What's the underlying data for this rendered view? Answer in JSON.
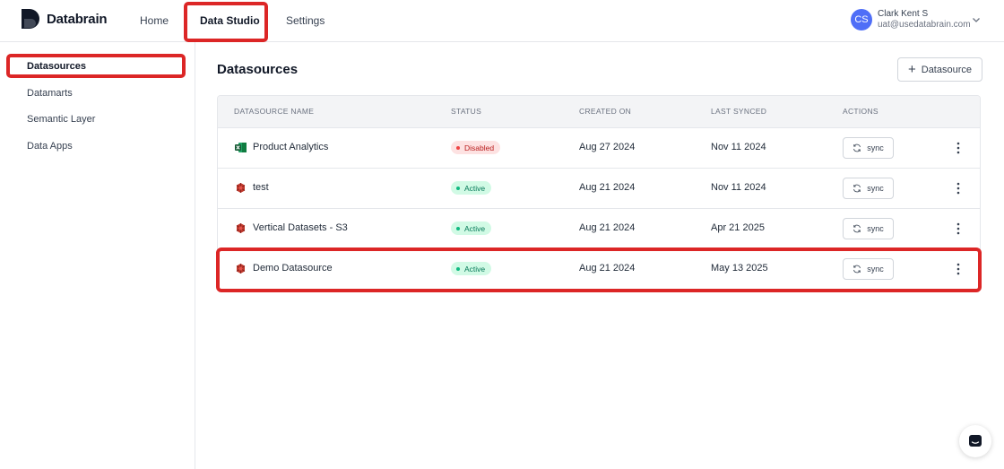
{
  "app": {
    "name": "Databrain"
  },
  "nav": {
    "home": "Home",
    "data_studio": "Data Studio",
    "settings": "Settings"
  },
  "user": {
    "initials": "CS",
    "name": "Clark Kent S",
    "email": "uat@usedatabrain.com"
  },
  "sidebar": {
    "items": [
      {
        "label": "Datasources",
        "active": true
      },
      {
        "label": "Datamarts"
      },
      {
        "label": "Semantic Layer"
      },
      {
        "label": "Data Apps"
      }
    ]
  },
  "main": {
    "title": "Datasources",
    "add_button": "Datasource",
    "columns": {
      "name": "DATASOURCE NAME",
      "status": "STATUS",
      "created": "CREATED ON",
      "synced": "LAST SYNCED",
      "actions": "ACTIONS"
    },
    "rows": [
      {
        "name": "Product Analytics",
        "icon": "excel-icon",
        "status": "Disabled",
        "created": "Aug 27 2024",
        "synced": "Nov 11 2024",
        "action": "sync"
      },
      {
        "name": "test",
        "icon": "redshift-icon",
        "status": "Active",
        "created": "Aug 21 2024",
        "synced": "Nov 11 2024",
        "action": "sync"
      },
      {
        "name": "Vertical Datasets - S3",
        "icon": "redshift-icon",
        "status": "Active",
        "created": "Aug 21 2024",
        "synced": "Apr 21 2025",
        "action": "sync"
      },
      {
        "name": "Demo Datasource",
        "icon": "redshift-icon",
        "status": "Active",
        "created": "Aug 21 2024",
        "synced": "May 13 2025",
        "action": "sync"
      }
    ]
  },
  "colors": {
    "highlight": "#dc2626",
    "avatar": "#4f6ef7",
    "active": "#047857",
    "disabled": "#b91c1c"
  }
}
